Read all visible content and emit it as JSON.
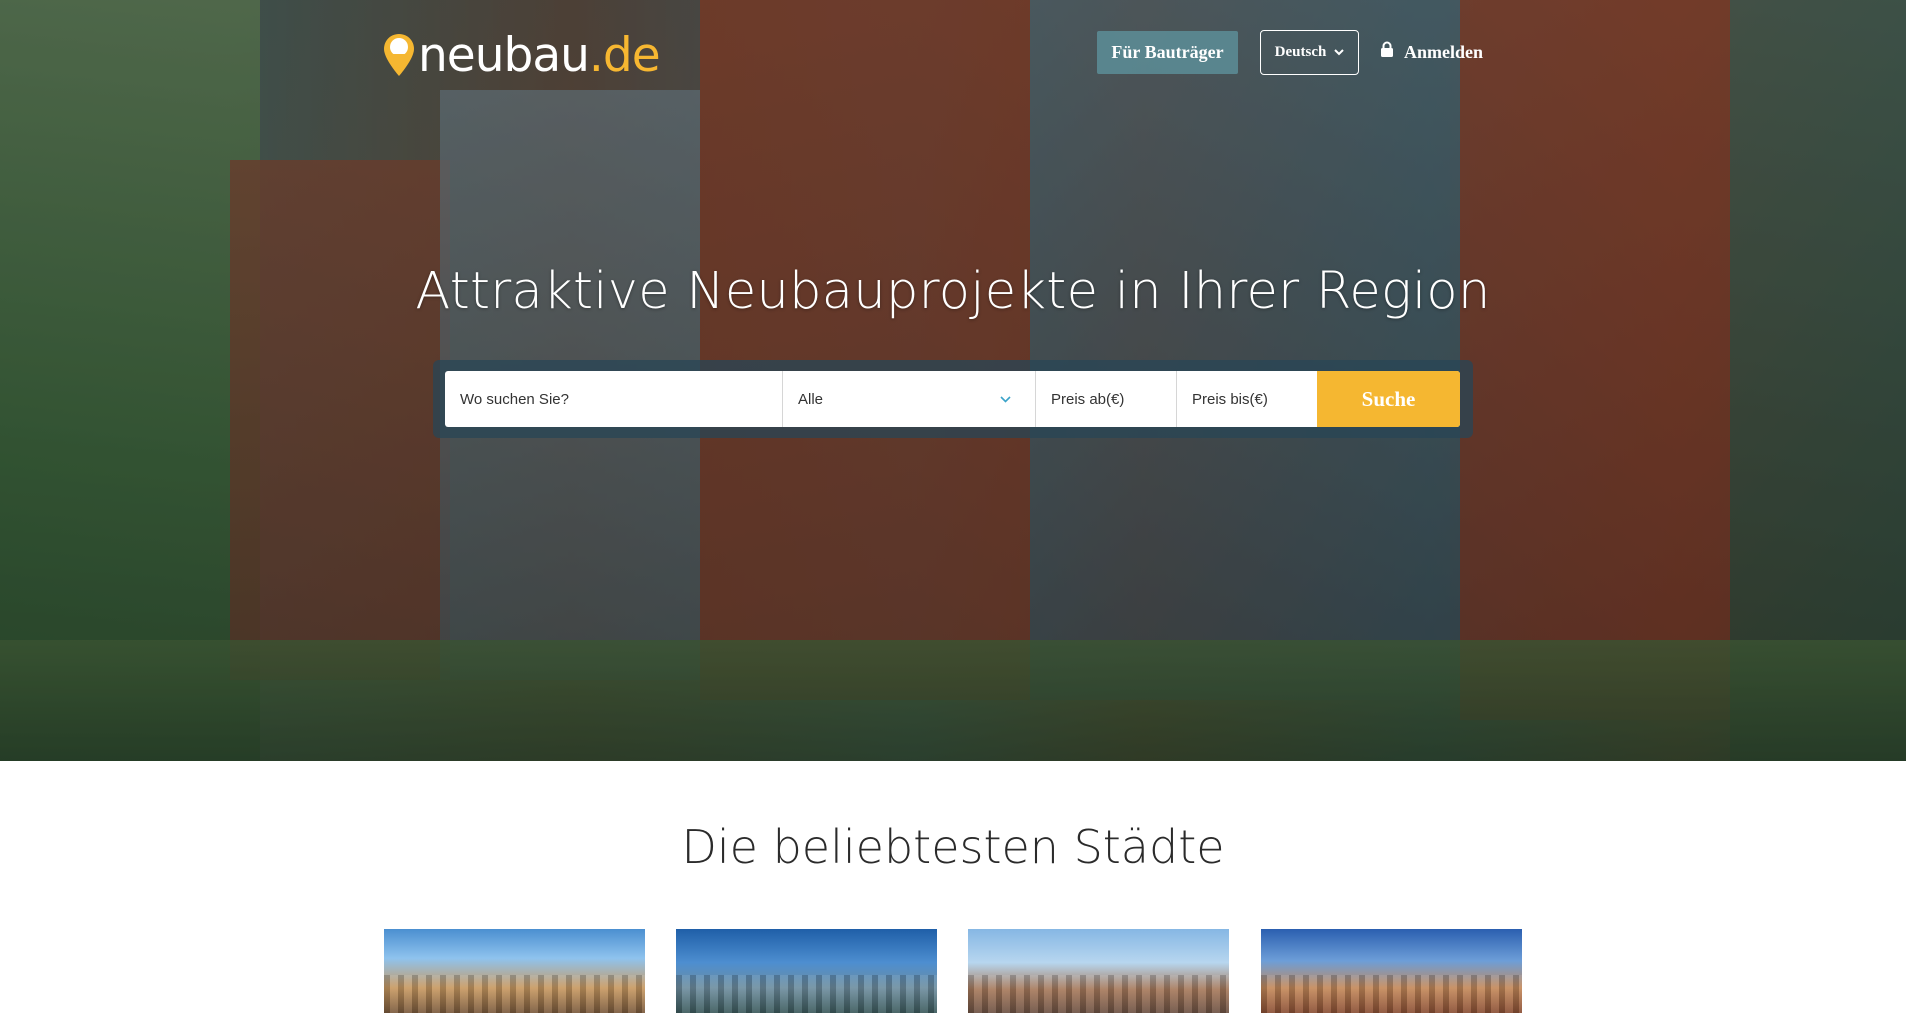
{
  "header": {
    "logo_word": "neubau",
    "logo_tld": ".de",
    "developer_button": "Für Bauträger",
    "language": "Deutsch",
    "login": "Anmelden"
  },
  "hero": {
    "headline": "Attraktive Neubauprojekte in Ihrer Region"
  },
  "search": {
    "location_placeholder": "Wo suchen Sie?",
    "type_selected": "Alle",
    "price_from_placeholder": "Preis ab(€)",
    "price_to_placeholder": "Preis bis(€)",
    "submit": "Suche"
  },
  "cities": {
    "title": "Die beliebtesten Städte"
  },
  "colors": {
    "accent": "#f5b731",
    "select_chevron": "#3ba3c9"
  },
  "icons": [
    "map-pin-logo-icon",
    "chevron-down-icon",
    "lock-icon"
  ]
}
